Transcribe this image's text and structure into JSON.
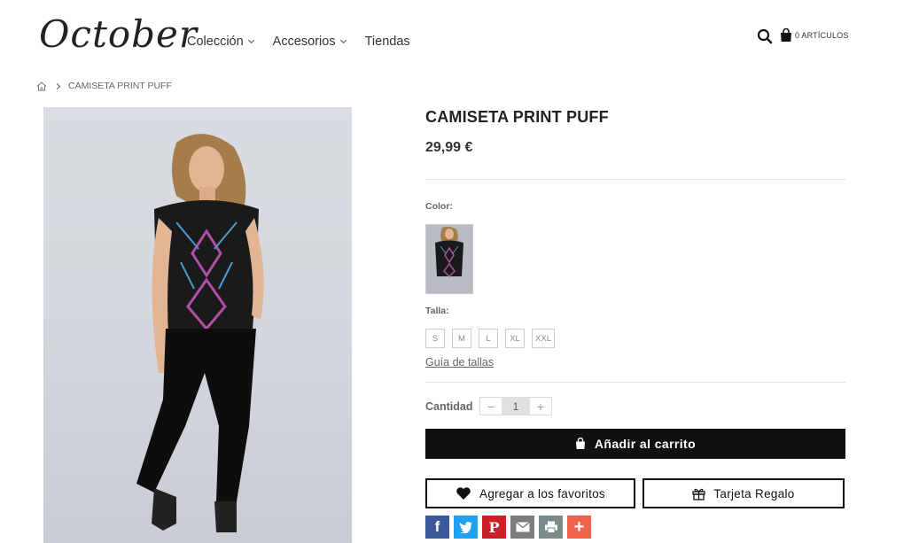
{
  "header": {
    "logo": "October",
    "nav": [
      {
        "label": "Colección",
        "has_dropdown": true
      },
      {
        "label": "Accesorios",
        "has_dropdown": true
      },
      {
        "label": "Tiendas",
        "has_dropdown": false
      }
    ],
    "search_icon": "search-icon",
    "cart_icon": "shopping-bag-icon",
    "cart_label": "0 ARTÍCULOS"
  },
  "breadcrumb": {
    "home_icon": "home-icon",
    "current": "CAMISETA PRINT PUFF"
  },
  "product": {
    "title": "CAMISETA PRINT PUFF",
    "price": "29,99 €",
    "color_label": "Color:",
    "size_label": "Talla:",
    "sizes": [
      "S",
      "M",
      "L",
      "XL",
      "XXL"
    ],
    "size_guide": "Guía de tallas",
    "quantity_label": "Cantidad",
    "quantity": "1",
    "add_to_cart": "Añadir al carrito",
    "add_to_favorites": "Agregar a los favoritos",
    "gift_card": "Tarjeta Regalo"
  },
  "share": [
    {
      "icon": "facebook-icon",
      "glyph": "f",
      "color": "#3b5998"
    },
    {
      "icon": "twitter-icon",
      "glyph": "",
      "color": "#1da1f2"
    },
    {
      "icon": "pinterest-icon",
      "glyph": "P",
      "color": "#cb2027"
    },
    {
      "icon": "email-icon",
      "glyph": "",
      "color": "#7d7d7d"
    },
    {
      "icon": "print-icon",
      "glyph": "",
      "color": "#7d8a8a"
    },
    {
      "icon": "more-icon",
      "glyph": "+",
      "color": "#f0624a"
    }
  ],
  "colors": {
    "primary_button": "#111111",
    "divider": "#e3e3e3"
  }
}
